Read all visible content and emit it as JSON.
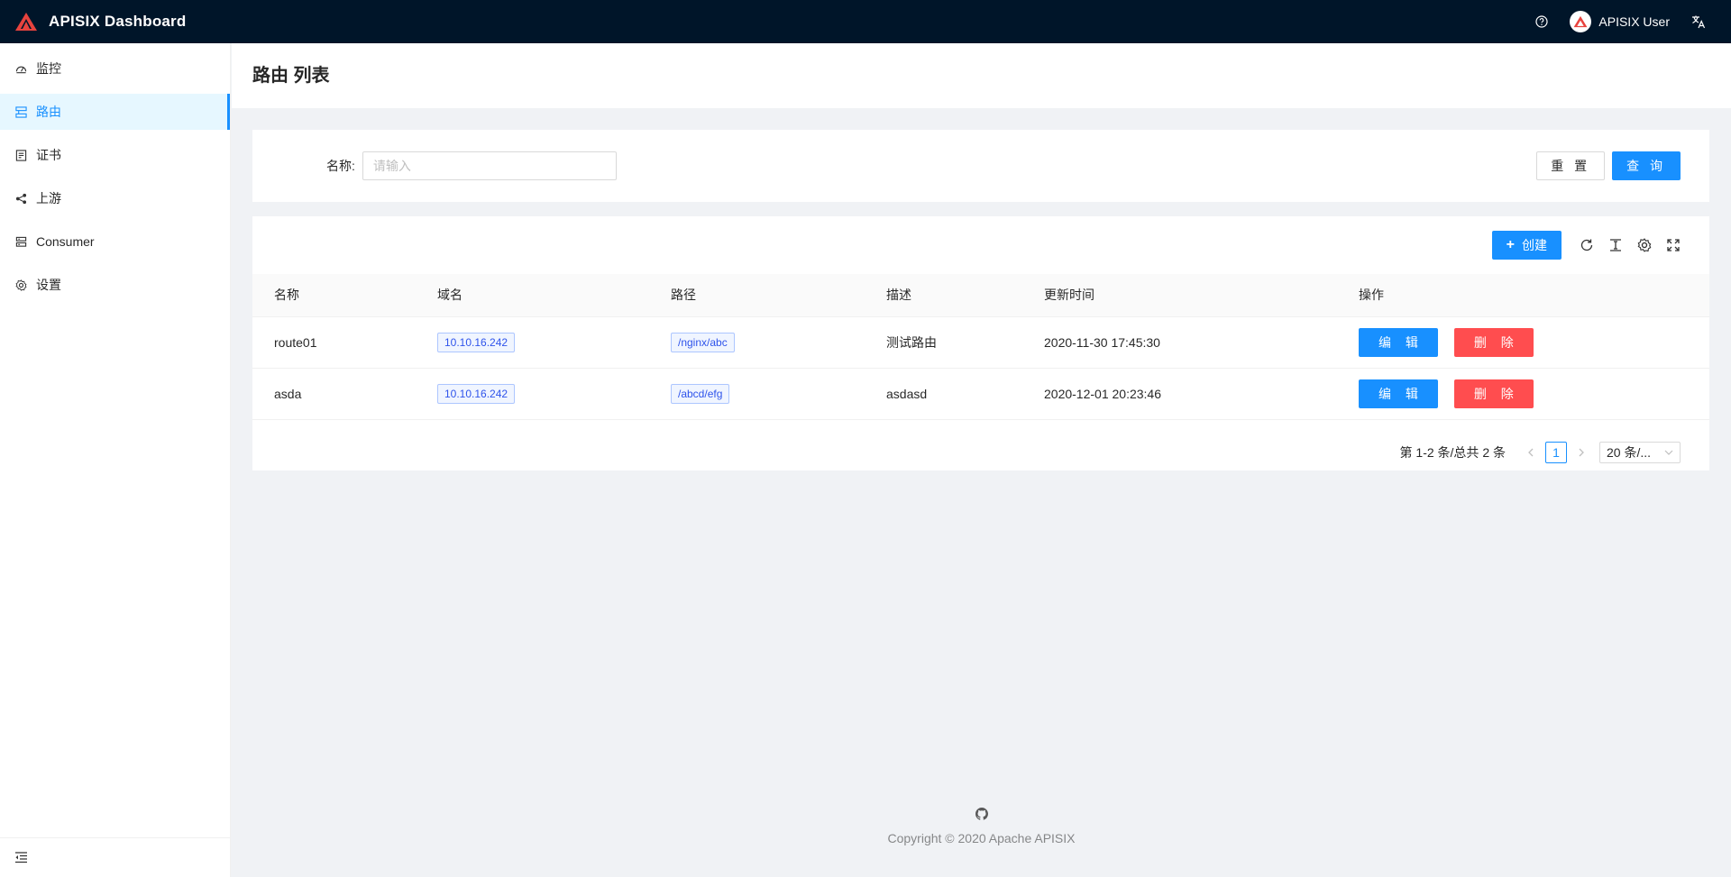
{
  "header": {
    "title": "APISIX Dashboard",
    "user_name": "APISIX User",
    "help_icon": "question-circle-icon",
    "lang_icon": "translation-icon"
  },
  "sidebar": {
    "items": [
      {
        "label": "监控",
        "icon": "dashboard-icon"
      },
      {
        "label": "路由",
        "icon": "route-icon",
        "active": true
      },
      {
        "label": "证书",
        "icon": "certificate-icon"
      },
      {
        "label": "上游",
        "icon": "upstream-icon"
      },
      {
        "label": "Consumer",
        "icon": "consumer-icon"
      },
      {
        "label": "设置",
        "icon": "setting-icon"
      }
    ],
    "collapse_icon": "menu-fold-icon"
  },
  "page": {
    "title": "路由 列表"
  },
  "search": {
    "label": "名称:",
    "placeholder": "请输入",
    "value": "",
    "reset_label": "重 置",
    "query_label": "查 询"
  },
  "toolbar": {
    "create_label": "创建"
  },
  "table": {
    "columns": [
      "名称",
      "域名",
      "路径",
      "描述",
      "更新时间",
      "操作"
    ],
    "rows": [
      {
        "name": "route01",
        "host": "10.10.16.242",
        "path": "/nginx/abc",
        "desc": "测试路由",
        "updated": "2020-11-30 17:45:30",
        "edit": "编 辑",
        "delete": "删 除"
      },
      {
        "name": "asda",
        "host": "10.10.16.242",
        "path": "/abcd/efg",
        "desc": "asdasd",
        "updated": "2020-12-01 20:23:46",
        "edit": "编 辑",
        "delete": "删 除"
      }
    ]
  },
  "pagination": {
    "total_text": "第 1-2 条/总共 2 条",
    "current_page": "1",
    "page_size": "20 条/..."
  },
  "footer": {
    "copyright": "Copyright © 2020 Apache APISIX"
  },
  "colors": {
    "header_bg": "#001529",
    "primary": "#1890ff",
    "danger": "#ff4d4f",
    "tag_text": "#2f54eb"
  }
}
